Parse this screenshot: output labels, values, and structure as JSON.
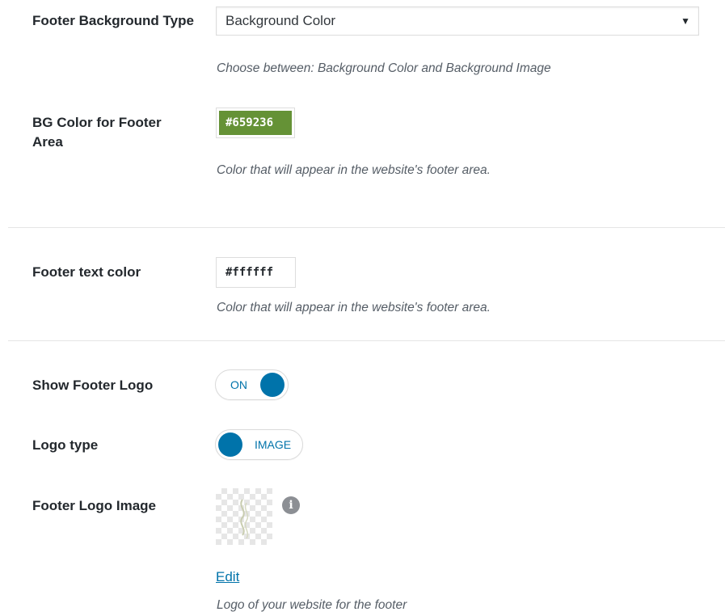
{
  "footer_bg_type": {
    "label": "Footer Background Type",
    "selected": "Background Color",
    "description": "Choose between: Background Color and Background Image"
  },
  "bg_color": {
    "label": "BG Color for Footer Area",
    "value": "#659236",
    "swatch_color": "#659236",
    "description": "Color that will appear in the website's footer area."
  },
  "text_color": {
    "label": "Footer text color",
    "value": "#ffffff",
    "description": "Color that will appear in the website's footer area."
  },
  "show_footer_logo": {
    "label": "Show Footer Logo",
    "state": "ON"
  },
  "logo_type": {
    "label": "Logo type",
    "state": "IMAGE"
  },
  "footer_logo_image": {
    "label": "Footer Logo Image",
    "edit_link": "Edit",
    "description": "Logo of your website for the footer"
  },
  "colors": {
    "accent": "#0073aa",
    "info_icon": "#8c8f94"
  }
}
